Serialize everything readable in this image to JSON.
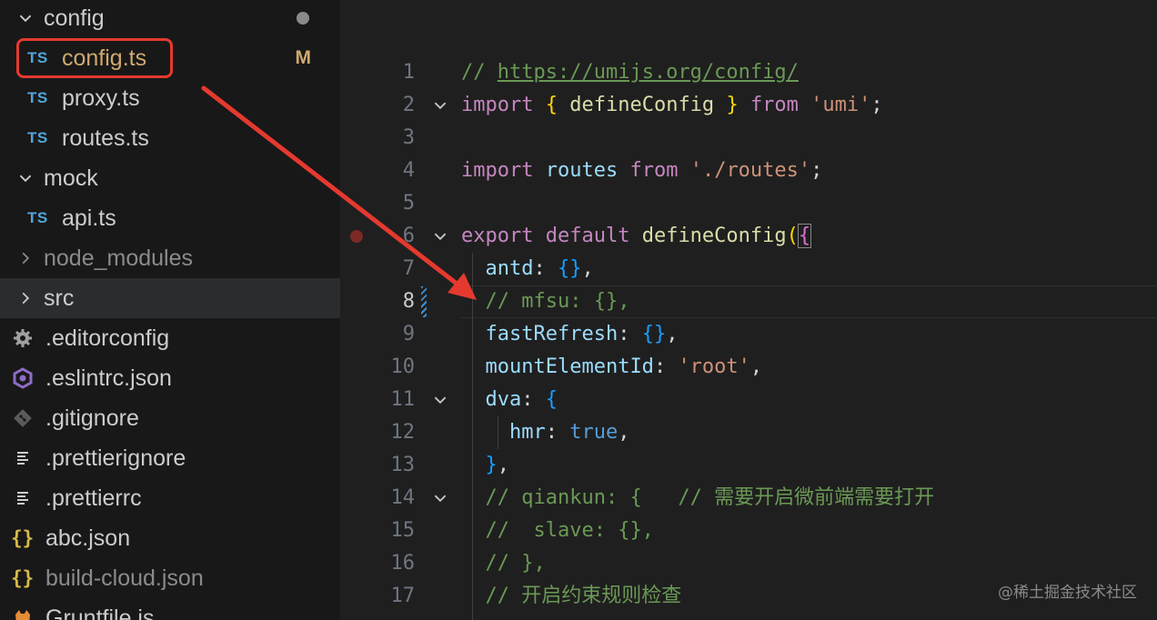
{
  "explorer": {
    "items": [
      {
        "label": "config",
        "kind": "folder-open"
      },
      {
        "label": "config.ts",
        "kind": "ts",
        "badge": "M"
      },
      {
        "label": "proxy.ts",
        "kind": "ts"
      },
      {
        "label": "routes.ts",
        "kind": "ts"
      },
      {
        "label": "mock",
        "kind": "folder-open"
      },
      {
        "label": "api.ts",
        "kind": "ts"
      },
      {
        "label": "node_modules",
        "kind": "folder-closed"
      },
      {
        "label": "src",
        "kind": "folder-closed"
      },
      {
        "label": ".editorconfig",
        "kind": "gear"
      },
      {
        "label": ".eslintrc.json",
        "kind": "eslint"
      },
      {
        "label": ".gitignore",
        "kind": "git"
      },
      {
        "label": ".prettierignore",
        "kind": "lines"
      },
      {
        "label": ".prettierrc",
        "kind": "lines"
      },
      {
        "label": "abc.json",
        "kind": "json"
      },
      {
        "label": "build-cloud.json",
        "kind": "json"
      },
      {
        "label": "Gruntfile.js",
        "kind": "grunt"
      }
    ],
    "ts_icon_text": "TS",
    "json_icon_text": "{}"
  },
  "editor": {
    "line_numbers": [
      "1",
      "2",
      "3",
      "4",
      "5",
      "6",
      "7",
      "8",
      "9",
      "10",
      "11",
      "12",
      "13",
      "14",
      "15",
      "16",
      "17"
    ],
    "lines": {
      "l1_comment": "// ",
      "l1_url": "https://umijs.org/config/",
      "l2_import": "import",
      "l2_brace_open": "{",
      "l2_name": "defineConfig",
      "l2_brace_close": "}",
      "l2_from": "from",
      "l2_str": "'umi'",
      "l2_semi": ";",
      "l4_import": "import",
      "l4_name": "routes",
      "l4_from": "from",
      "l4_str": "'./routes'",
      "l4_semi": ";",
      "l6_export": "export",
      "l6_default": "default",
      "l6_fn": "defineConfig",
      "l6_paren": "(",
      "l6_brace": "{",
      "l7_key": "antd",
      "l7_rest": ": ",
      "l7_obj": "{}",
      "l7_comma": ",",
      "l8_comment": "// mfsu: {},",
      "l9_key": "fastRefresh",
      "l9_rest": ": ",
      "l9_obj": "{}",
      "l9_comma": ",",
      "l10_key": "mountElementId",
      "l10_rest": ": ",
      "l10_str": "'root'",
      "l10_comma": ",",
      "l11_key": "dva",
      "l11_rest": ": ",
      "l11_brace": "{",
      "l12_key": "hmr",
      "l12_rest": ": ",
      "l12_val": "true",
      "l12_comma": ",",
      "l13_brace": "}",
      "l13_comma": ",",
      "l14_comment": "// qiankun: {   // 需要开启微前端需要打开",
      "l15_comment": "//  slave: {},",
      "l16_comment": "// },",
      "l17_comment": "// 开启约束规则检查"
    }
  },
  "watermark": "@稀土掘金技术社区",
  "colors": {
    "annotation": "#e5392f",
    "modified_badge": "#d0a96e",
    "ts_icon": "#4fa6dd"
  }
}
